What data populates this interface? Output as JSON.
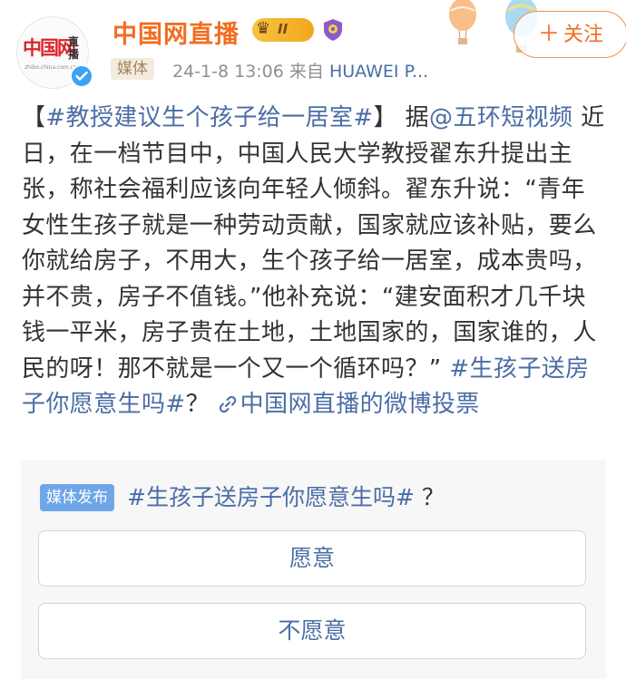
{
  "account": {
    "name": "中国网直播",
    "level_badge": "II",
    "tag": "媒体",
    "time": "24-1-8 13:06",
    "from_label": "来自",
    "source": "HUAWEI P...",
    "avatar_logo_cn": "中国网",
    "avatar_logo_zb": "直播",
    "avatar_url": "zhibo.china.com.cn"
  },
  "follow": {
    "plus": "＋",
    "label": "关注"
  },
  "post": {
    "open_bracket": "【",
    "topic": "#教授建议生个孩子给一居室#",
    "close_bracket": "】 据",
    "mention": "@五环短视频",
    "body": " 近日，在一档节目中，中国人民大学教授翟东升提出主张，称社会福利应该向年轻人倾斜。翟东升说：“青年女性生孩子就是一种劳动贡献，国家就应该补贴，要么你就给房子，不用大，生个孩子给一居室，成本贵吗，并不贵，房子不值钱。”他补充说：“建安面积才几千块钱一平米，房子贵在土地，土地国家的，国家谁的，人民的呀！那不就是一个又一个循环吗？” ",
    "topic2": "#生孩子送房子你愿意生吗#",
    "qmark": "？ ",
    "link_text": "中国网直播的微博投票"
  },
  "vote": {
    "badge": "媒体发布",
    "question": "#生孩子送房子你愿意生吗#",
    "question_mark": " ？",
    "options": [
      "愿意",
      "不愿意"
    ]
  },
  "colors": {
    "brand_orange": "#f26d22",
    "link_blue": "#4a6da5",
    "verify_blue": "#3ca3f4",
    "badge_blue": "#6ea6e8"
  },
  "icons": [
    "crown-badge-icon",
    "shield-badge-icon",
    "verified-icon",
    "link-icon",
    "balloon-icon"
  ]
}
